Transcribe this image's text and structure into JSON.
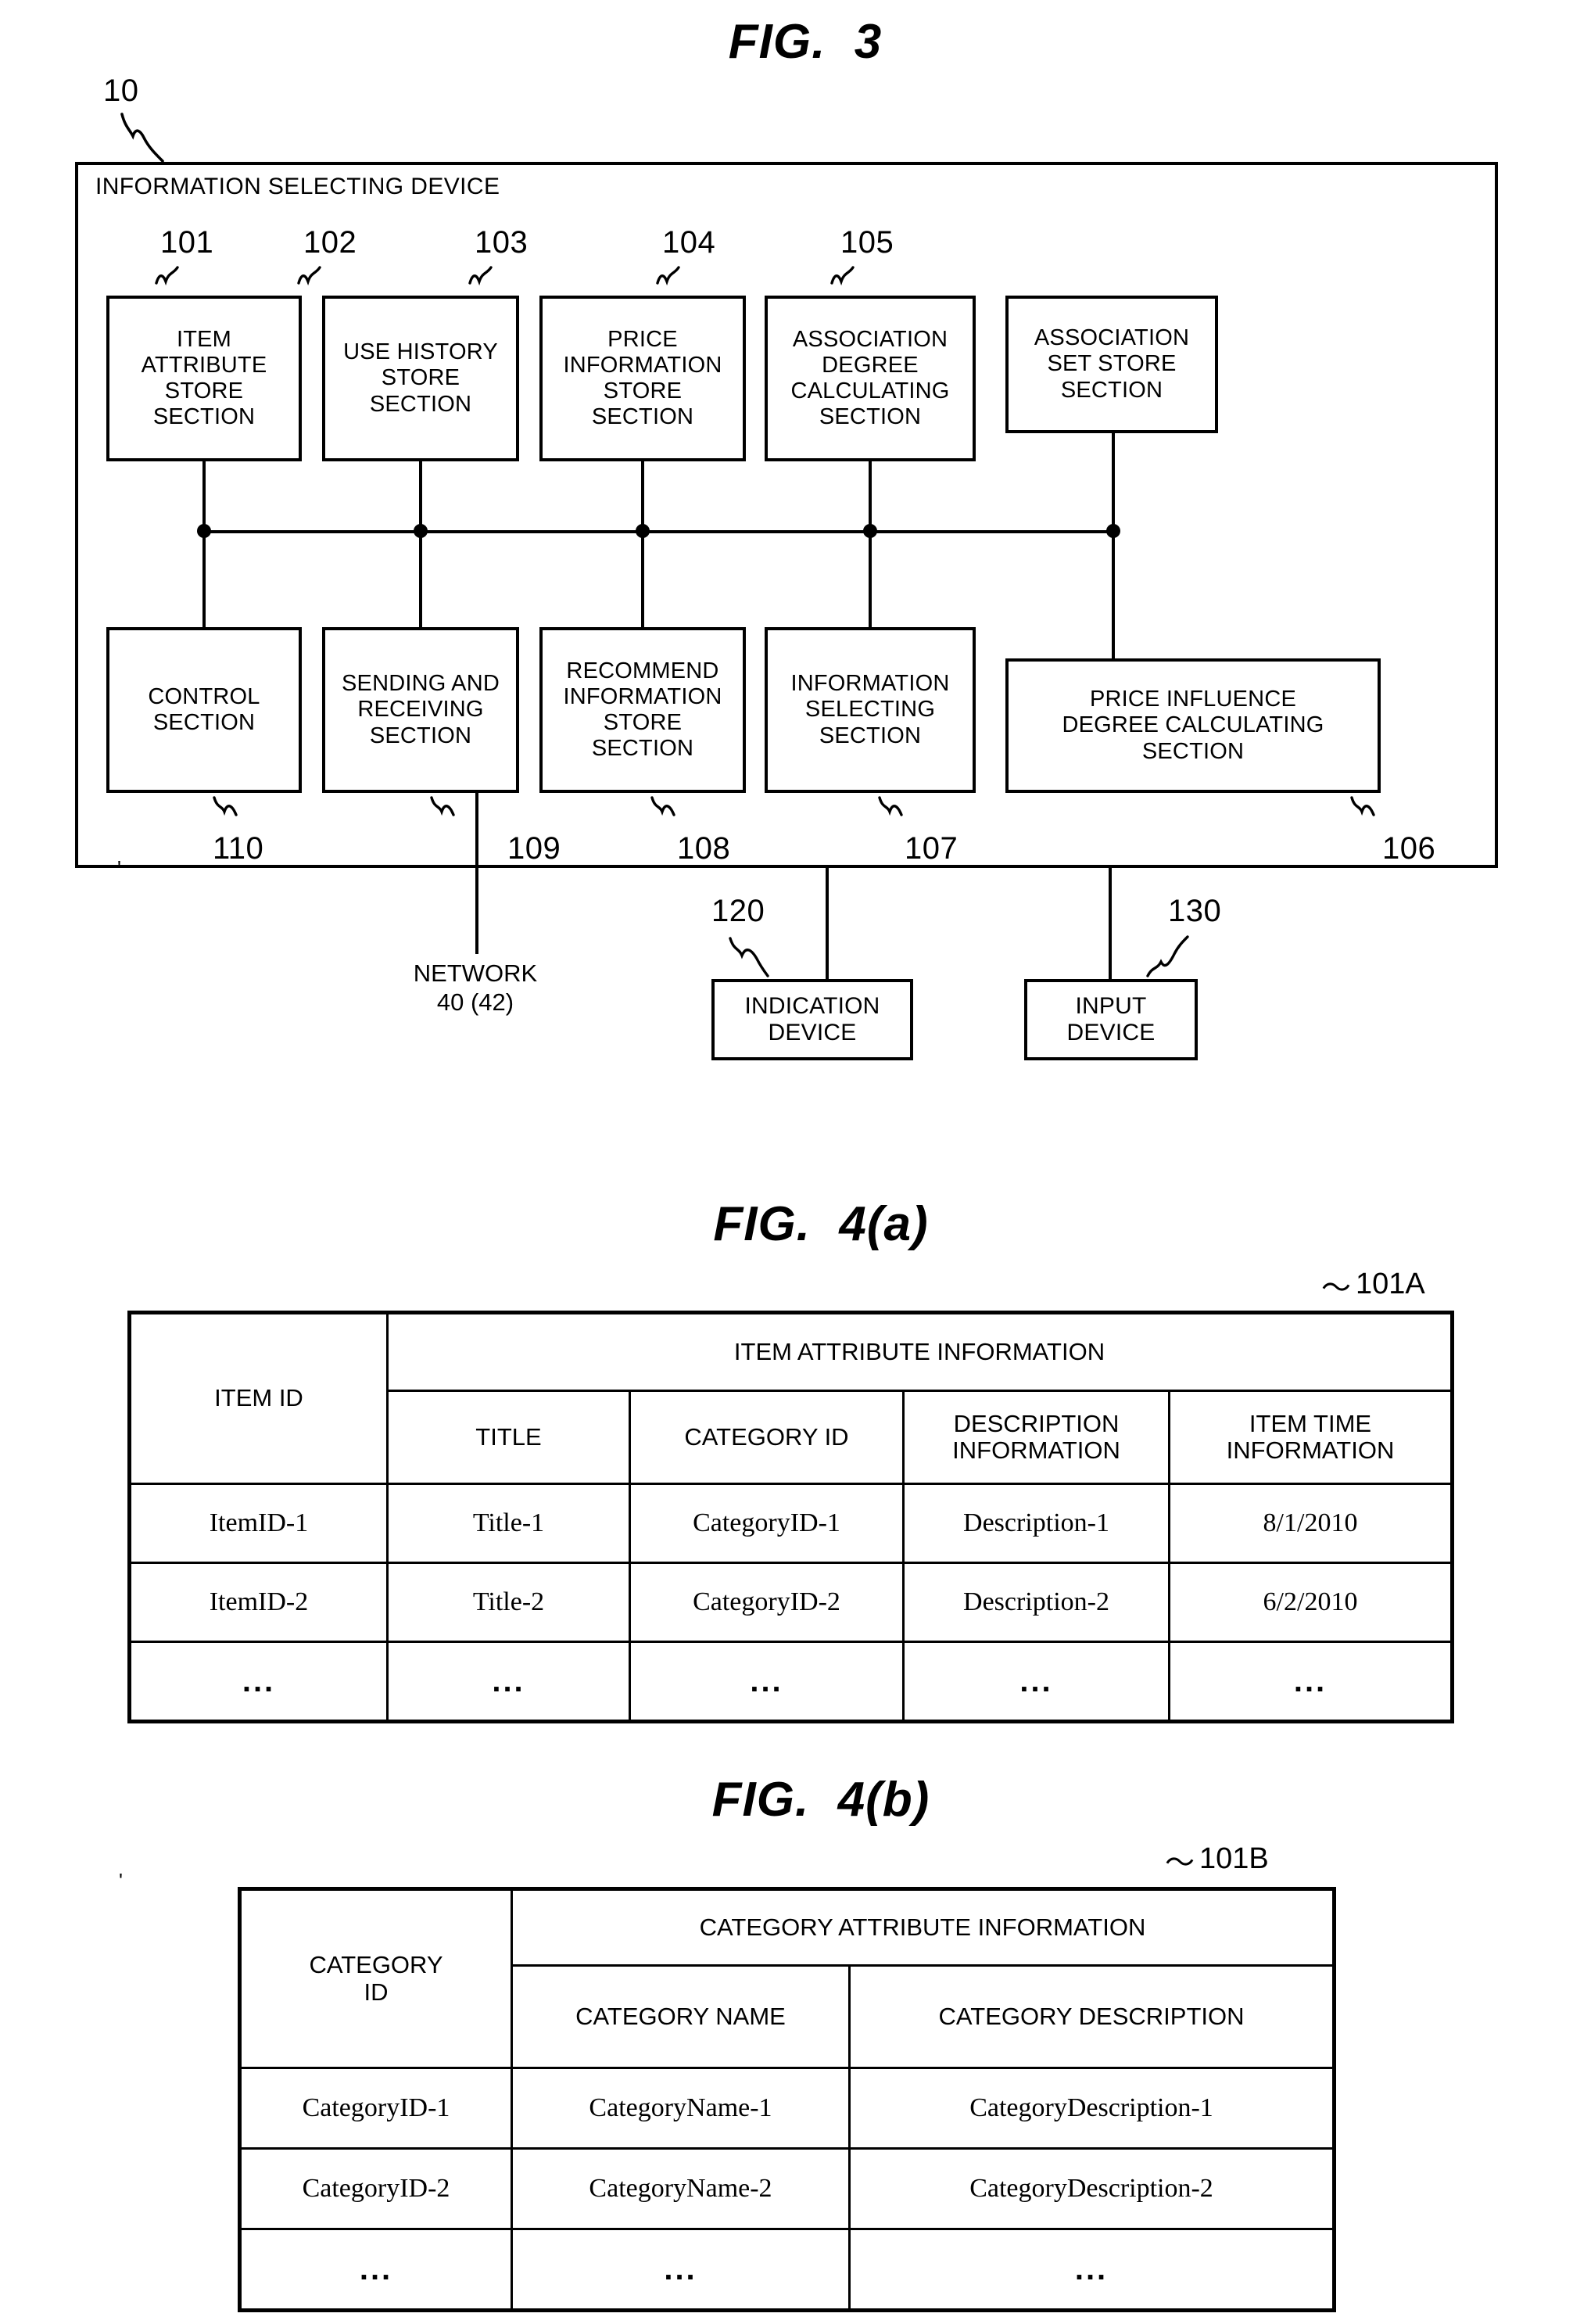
{
  "figures": {
    "fig3": {
      "title": "FIG.  3",
      "device_ref": "10",
      "device_title": "INFORMATION SELECTING DEVICE",
      "top_row": [
        {
          "ref": "101",
          "label": "ITEM\nATTRIBUTE\nSTORE\nSECTION"
        },
        {
          "ref": "102",
          "label": "USE HISTORY\nSTORE\nSECTION"
        },
        {
          "ref": "103",
          "label": "PRICE\nINFORMATION\nSTORE\nSECTION"
        },
        {
          "ref": "104",
          "label": "ASSOCIATION\nDEGREE\nCALCULATING\nSECTION"
        },
        {
          "ref": "105",
          "label": "ASSOCIATION\nSET STORE\nSECTION"
        }
      ],
      "bottom_row": [
        {
          "ref": "110",
          "label": "CONTROL\nSECTION"
        },
        {
          "ref": "109",
          "label": "SENDING AND\nRECEIVING\nSECTION"
        },
        {
          "ref": "108",
          "label": "RECOMMEND\nINFORMATION\nSTORE\nSECTION"
        },
        {
          "ref": "107",
          "label": "INFORMATION\nSELECTING\nSECTION"
        },
        {
          "ref": "106",
          "label": "PRICE INFLUENCE\nDEGREE CALCULATING\nSECTION"
        }
      ],
      "external": [
        {
          "ref": "120",
          "label": "INDICATION\nDEVICE"
        },
        {
          "ref": "130",
          "label": "INPUT\nDEVICE"
        }
      ],
      "network_label": "NETWORK\n40 (42)"
    },
    "fig4a": {
      "title": "FIG.  4(a)",
      "table_ref": "101A",
      "group_header": "ITEM ATTRIBUTE INFORMATION",
      "id_header": "ITEM ID",
      "sub_headers": [
        "TITLE",
        "CATEGORY ID",
        "DESCRIPTION\nINFORMATION",
        "ITEM TIME\nINFORMATION"
      ],
      "rows": [
        [
          "ItemID-1",
          "Title-1",
          "CategoryID-1",
          "Description-1",
          "8/1/2010"
        ],
        [
          "ItemID-2",
          "Title-2",
          "CategoryID-2",
          "Description-2",
          "6/2/2010"
        ],
        [
          "...",
          "...",
          "...",
          "...",
          "..."
        ]
      ]
    },
    "fig4b": {
      "title": "FIG.  4(b)",
      "table_ref": "101B",
      "group_header": "CATEGORY ATTRIBUTE INFORMATION",
      "id_header": "CATEGORY\nID",
      "sub_headers": [
        "CATEGORY NAME",
        "CATEGORY DESCRIPTION"
      ],
      "rows": [
        [
          "CategoryID-1",
          "CategoryName-1",
          "CategoryDescription-1"
        ],
        [
          "CategoryID-2",
          "CategoryName-2",
          "CategoryDescription-2"
        ],
        [
          "...",
          "...",
          "..."
        ]
      ]
    }
  },
  "colors": {
    "ink": "#000000",
    "paper": "#ffffff"
  }
}
